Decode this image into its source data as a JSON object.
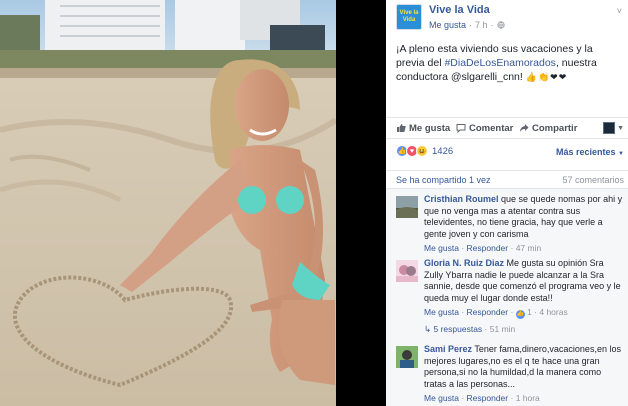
{
  "page": {
    "avatar_text": "Vive la Vida",
    "name": "Vive la Vida",
    "liked": "Me gusta",
    "time": "7 h",
    "chevron": "˅"
  },
  "post": {
    "text_before": "¡A pleno esta viviendo sus vacaciones y la previa del ",
    "hashtag": "#DiaDeLosEnamorados",
    "text_after": ", nuestra conductora @slgarelli_cnn! ",
    "emojis": "👍👏❤❤"
  },
  "actions": {
    "like": "Me gusta",
    "comment": "Comentar",
    "share": "Compartir"
  },
  "reactions": {
    "count": "1426",
    "sort": "Más recientes"
  },
  "shared": {
    "left": "Se ha compartido 1 vez",
    "right": "57 comentarios"
  },
  "comments": [
    {
      "name": "Cristhian Roumel",
      "text": "que se quede nomas por ahi y que no venga mas a atentar contra sus televidentes, no tiene gracia, hay que verle a gente joven y con carisma",
      "like": "Me gusta",
      "reply": "Responder",
      "time": "47 min"
    },
    {
      "name": "Gloria N. Ruiz Diaz",
      "text": "Me gusta su opinión Sra Zully Ybarra nadie le puede alcanzar a la Sra sannie, desde que comenzó el programa veo y le queda muy el lugar donde esta!!",
      "like": "Me gusta",
      "reply": "Responder",
      "likes": "1",
      "time": "4 horas",
      "replies": "5 respuestas",
      "replies_time": "51 min"
    },
    {
      "name": "Sami Perez",
      "text": "Tener fama,dinero,vacaciones,en los mejores lugares,no es el q te hace una gran persona,si no la humildad,d la manera como tratas a las personas...",
      "like": "Me gusta",
      "reply": "Responder",
      "time": "1 hora"
    }
  ],
  "colors": {
    "link": "#365899",
    "muted": "#90949c",
    "text": "#1d2129"
  }
}
